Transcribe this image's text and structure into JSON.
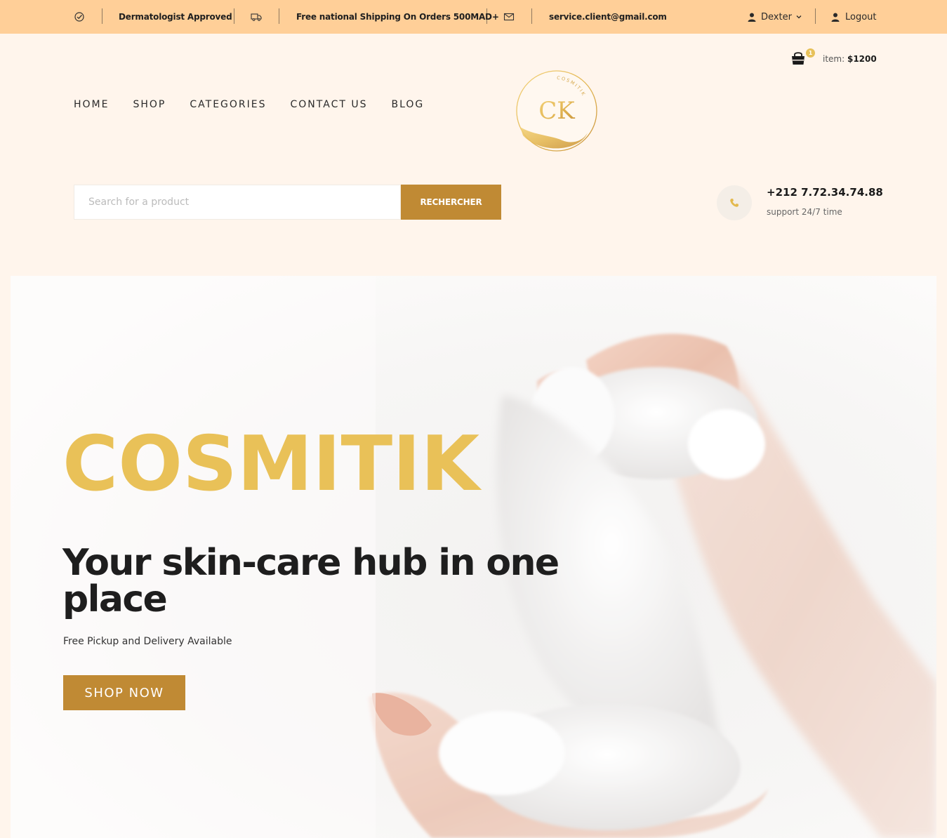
{
  "topbar": {
    "approved": "Dermatologist Approved",
    "shipping": "Free national Shipping On Orders 500MAD+",
    "email": "service.client@gmail.com",
    "user": "Dexter",
    "logout": "Logout"
  },
  "cart": {
    "count": "1",
    "label": "item:",
    "total": "$1200"
  },
  "nav": {
    "items": [
      "HOME",
      "SHOP",
      "CATEGORIES",
      "CONTACT US",
      "BLOG"
    ]
  },
  "logo": {
    "monogram": "CK",
    "ring_text": "COSMITIK"
  },
  "search": {
    "placeholder": "Search for a product",
    "value": "",
    "button": "RECHERCHER"
  },
  "contact": {
    "phone": "+212 7.72.34.74.88",
    "support": "support 24/7 time"
  },
  "hero": {
    "brand": "COSMITIK",
    "heading": "Your skin-care hub in one place",
    "subtitle": "Free Pickup and Delivery Available",
    "cta": "SHOP NOW"
  },
  "colors": {
    "topbar": "#ffcf98",
    "page_bg": "#fff5ec",
    "accent": "#c08a34",
    "brand_gold": "#e9c158"
  }
}
